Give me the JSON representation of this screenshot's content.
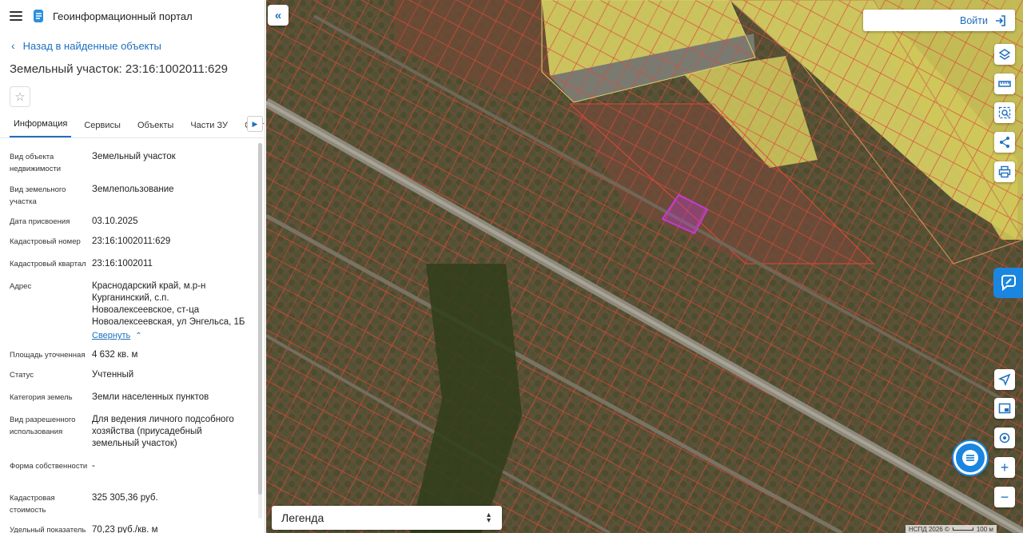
{
  "header": {
    "title": "Геоинформационный портал"
  },
  "back_link": {
    "label": "Назад в найденные объекты"
  },
  "parcel": {
    "title": "Земельный участок: 23:16:1002011:629"
  },
  "tabs": [
    {
      "label": "Информация",
      "active": true
    },
    {
      "label": "Сервисы",
      "active": false
    },
    {
      "label": "Объекты",
      "active": false
    },
    {
      "label": "Части ЗУ",
      "active": false
    },
    {
      "label": "Соста",
      "active": false
    }
  ],
  "info": {
    "rows": [
      {
        "key": "Вид объекта недвижимости",
        "value": "Земельный участок"
      },
      {
        "key": "Вид земельного участка",
        "value": "Землепользование"
      },
      {
        "key": "Дата присвоения",
        "value": "03.10.2025"
      },
      {
        "key": "Кадастровый номер",
        "value": "23:16:1002011:629"
      },
      {
        "key": "Кадастровый квартал",
        "value": "23:16:1002011"
      },
      {
        "key": "Адрес",
        "value": "Краснодарский край, м.р-н Курганинский, с.п. Новоалексеевское, ст-ца Новоалексеевская, ул Энгельса, 1Б"
      },
      {
        "key": "Площадь уточненная",
        "value": "4 632 кв. м"
      },
      {
        "key": "Статус",
        "value": "Учтенный"
      },
      {
        "key": "Категория земель",
        "value": "Земли населенных пунктов"
      },
      {
        "key": "Вид разрешенного использования",
        "value": "Для ведения личного подсобного хозяйства (приусадебный земельный участок)"
      },
      {
        "key": "Форма собственности",
        "value": "-"
      },
      {
        "key": "Кадастровая стоимость",
        "value": "325 305,36 руб."
      },
      {
        "key": "Удельный показатель",
        "value": "70,23 руб./кв. м"
      }
    ],
    "collapse_label": "Свернуть"
  },
  "map": {
    "login_label": "Войти",
    "legend_label": "Легенда",
    "attribution": "НСПД 2026 ©",
    "scale_label": "100 м",
    "toolbar_icons": [
      "layers-icon",
      "ruler-icon",
      "select-area-icon",
      "share-icon",
      "print-icon"
    ],
    "nav_icons": [
      "geolocation-icon",
      "minimap-icon",
      "my-location-icon",
      "zoom-in-icon",
      "zoom-out-icon"
    ]
  },
  "colors": {
    "accent": "#1f6fbf",
    "parcel_outline": "#e0483a",
    "selected_parcel": "#c23bd6",
    "agri_field": "#d7cf63",
    "chat_button": "#1a86e0"
  }
}
